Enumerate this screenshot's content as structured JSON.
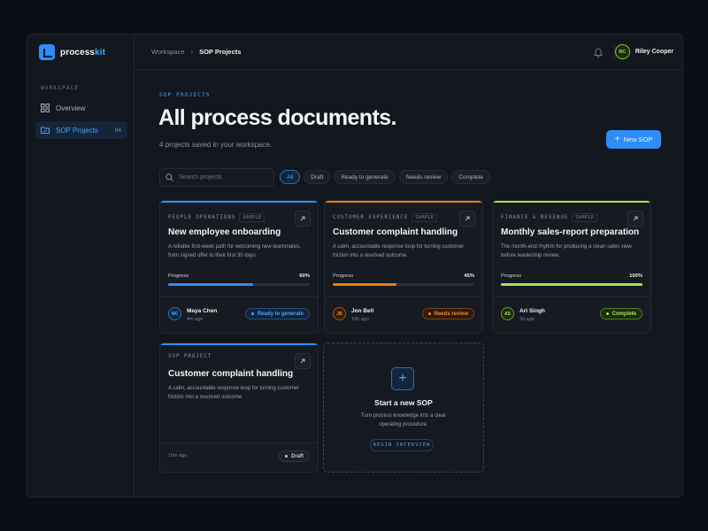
{
  "brand": {
    "name_prefix": "process",
    "name_accent": "kit"
  },
  "sidebar": {
    "section_label": "WORKSPACE",
    "items": [
      {
        "label": "Overview",
        "icon": "grid-icon"
      },
      {
        "label": "SOP Projects",
        "icon": "folder-icon",
        "count": "04"
      }
    ]
  },
  "topbar": {
    "breadcrumb_root": "Workspace",
    "breadcrumb_sep": "›",
    "breadcrumb_current": "SOP Projects",
    "user_initials": "RC",
    "user_name": "Riley Cooper"
  },
  "header": {
    "eyebrow": "SOP PROJECTS",
    "title": "All process documents.",
    "subtitle": "4 projects saved in your workspace.",
    "new_button": "New SOP"
  },
  "search": {
    "placeholder": "Search projects"
  },
  "filters": [
    "All",
    "Draft",
    "Ready to generate",
    "Needs review",
    "Complete"
  ],
  "cards": [
    {
      "category": "PEOPLE OPERATIONS",
      "tag": "SAMPLE",
      "title": "New employee onboarding",
      "description": "A reliable first-week path for welcoming new teammates, from signed offer to their first 30 days.",
      "progress_label": "Progress",
      "progress_text": "60%",
      "progress": 0.6,
      "accent": "#2f8df7",
      "initials": "MC",
      "person": "Maya Chen",
      "when": "4m ago",
      "status": "Ready to generate",
      "status_color": "#4aa3ff"
    },
    {
      "category": "CUSTOMER EXPERIENCE",
      "tag": "SAMPLE",
      "title": "Customer complaint handling",
      "description": "A calm, accountable response loop for turning customer friction into a resolved outcome.",
      "progress_label": "Progress",
      "progress_text": "45%",
      "progress": 0.45,
      "accent": "#f07a1a",
      "initials": "JB",
      "person": "Jon Bell",
      "when": "19h ago",
      "status": "Needs review",
      "status_color": "#f08a2a"
    },
    {
      "category": "FINANCE & REVENUE",
      "tag": "SAMPLE",
      "title": "Monthly sales-report preparation",
      "description": "The month-end rhythm for producing a clean sales view before leadership review.",
      "progress_label": "Progress",
      "progress_text": "100%",
      "progress": 1.0,
      "accent": "#a6e34a",
      "initials": "AS",
      "person": "Ari Singh",
      "when": "3d ago",
      "status": "Complete",
      "status_color": "#a6e34a"
    },
    {
      "category": "SOP PROJECT",
      "title": "Customer complaint handling",
      "description": "A calm, accountable response loop for turning customer friction into a resolved outcome.",
      "accent": "#2f8df7",
      "when": "10m ago",
      "status": "Draft",
      "status_color": "#c2c8d2"
    }
  ],
  "new_card": {
    "title": "Start a new SOP",
    "description": "Turn process knowledge into a clear operating procedure.",
    "button": "BEGIN INTERVIEW"
  }
}
